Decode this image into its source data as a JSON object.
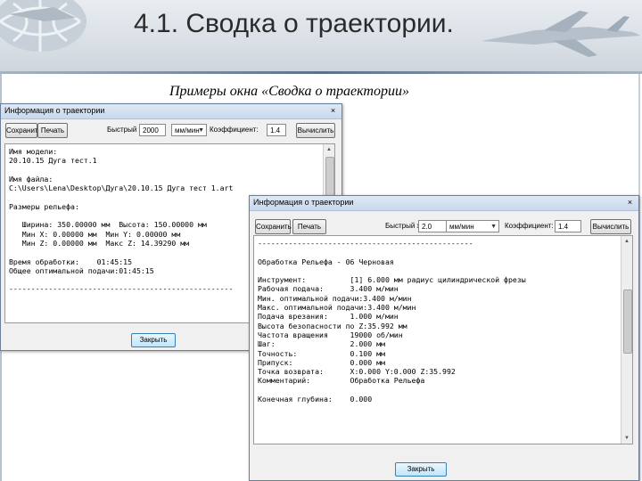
{
  "slide": {
    "title": "4.1. Сводка о траектории.",
    "subtitle": "Примеры окна «Сводка о траектории»"
  },
  "colors": {
    "header_band": "#d9dfe5",
    "titlebar": "#c9d9ee",
    "window_bg": "#f0f0f0",
    "close_button": "#bee6fd"
  },
  "window1": {
    "title": "Информация о траектории",
    "close_glyph": "×",
    "toolbar": {
      "save_label": "Сохранить",
      "print_label": "Печать",
      "speed_label": "Быстрый ход:",
      "speed_value": "2000",
      "speed_unit": "мм/мин",
      "coef_label": "Коэффициент:",
      "coef_value": "1.4",
      "calc_label": "Вычислить"
    },
    "content": "Имя модели:\n20.10.15 Дуга тест.1\n\nИмя файла:\nC:\\Users\\Lena\\Desktop\\Дуга\\20.10.15 Дуга тест 1.art\n\nРазмеры рельефа:\n\n   Ширина: 350.00000 мм  Высота: 150.00000 мм\n   Мин X: 0.00000 мм  Мин Y: 0.00000 мм\n   Мин Z: 0.00000 мм  Макс Z: 14.39290 мм\n\nВремя обработки:    01:45:15\nОбщее оптимальной подачи:01:45:15\n\n---------------------------------------------------",
    "close_button": "Закрыть"
  },
  "window2": {
    "title": "Информация о траектории",
    "close_glyph": "×",
    "toolbar": {
      "save_label": "Сохранить",
      "print_label": "Печать",
      "speed_label": "Быстрый ход:",
      "speed_value": "2.0",
      "speed_unit": "мм/мин",
      "coef_label": "Коэффициент:",
      "coef_value": "1.4",
      "calc_label": "Вычислить"
    },
    "content": "-------------------------------------------------\n\nОбработка Рельефа - 06 Черновая\n\nИнструмент:          [1] 6.000 мм радиус цилиндрической фрезы\nРабочая подача:      3.400 м/мин\nМин. оптимальной подачи:3.400 м/мин\nМакс. оптимальной подачи:3.400 м/мин\nПодача врезания:     1.000 м/мин\nВысота безопасности по Z:35.992 мм\nЧастота вращения     19000 об/мин\nШаг:                 2.000 мм\nТочность:            0.100 мм\nПрипуск:             0.000 мм\nТочка возврата:      X:0.000 Y:0.000 Z:35.992\nКомментарий:         Обработка Рельефа\n\nКонечная глубина:    0.000",
    "close_button": "Закрыть"
  }
}
